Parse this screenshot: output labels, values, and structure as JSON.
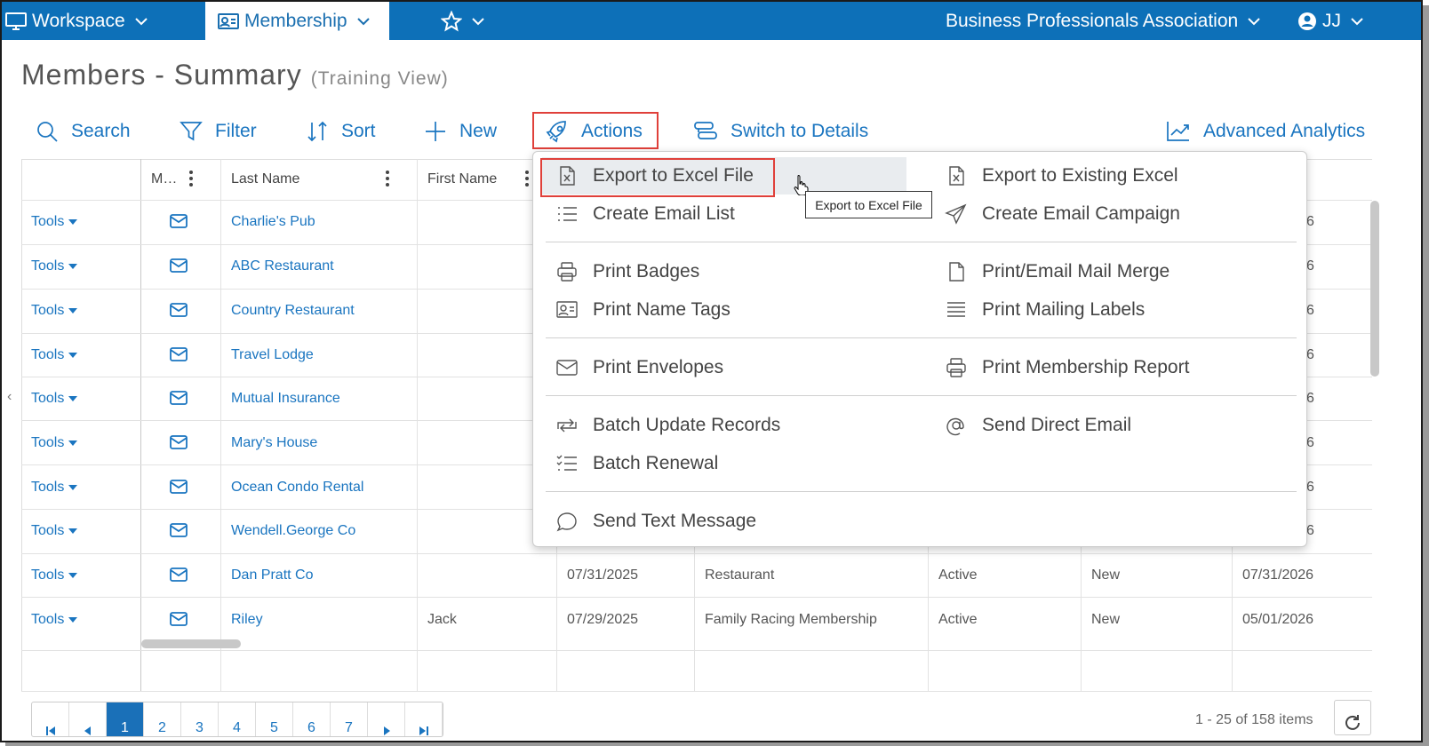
{
  "topnav": {
    "workspace": "Workspace",
    "membership": "Membership",
    "org": "Business Professionals Association",
    "user": "JJ"
  },
  "page": {
    "title": "Members - Summary",
    "subtitle": "(Training View)"
  },
  "toolbar": {
    "search": "Search",
    "filter": "Filter",
    "sort": "Sort",
    "new": "New",
    "actions": "Actions",
    "switch": "Switch to Details",
    "analytics": "Advanced Analytics"
  },
  "grid": {
    "headers": {
      "m": "M…",
      "last": "Last Name",
      "first": "First Name"
    },
    "tools_label": "Tools",
    "rows": [
      {
        "last": "Charlie's Pub",
        "first": "",
        "d1": "",
        "type": "",
        "status": "",
        "kind": "",
        "d2": "6"
      },
      {
        "last": "ABC Restaurant",
        "first": "",
        "d1": "",
        "type": "",
        "status": "",
        "kind": "",
        "d2": "6"
      },
      {
        "last": "Country Restaurant",
        "first": "",
        "d1": "",
        "type": "",
        "status": "",
        "kind": "",
        "d2": "6"
      },
      {
        "last": "Travel Lodge",
        "first": "",
        "d1": "",
        "type": "",
        "status": "",
        "kind": "",
        "d2": "6"
      },
      {
        "last": "Mutual Insurance",
        "first": "",
        "d1": "",
        "type": "",
        "status": "",
        "kind": "",
        "d2": "6"
      },
      {
        "last": "Mary's House",
        "first": "",
        "d1": "",
        "type": "",
        "status": "",
        "kind": "",
        "d2": "6"
      },
      {
        "last": "Ocean Condo Rental",
        "first": "",
        "d1": "",
        "type": "",
        "status": "",
        "kind": "",
        "d2": "6"
      },
      {
        "last": "Wendell.George Co",
        "first": "",
        "d1": "",
        "type": "",
        "status": "",
        "kind": "",
        "d2": "6"
      },
      {
        "last": "Dan Pratt Co",
        "first": "",
        "d1": "07/31/2025",
        "type": "Restaurant",
        "status": "Active",
        "kind": "New",
        "d2": "07/31/2026"
      },
      {
        "last": "Riley",
        "first": "Jack",
        "d1": "07/29/2025",
        "type": "Family Racing Membership",
        "status": "Active",
        "kind": "New",
        "d2": "05/01/2026"
      }
    ]
  },
  "pager": {
    "pages": [
      "1",
      "2",
      "3",
      "4",
      "5",
      "6",
      "7"
    ],
    "current": "1",
    "info": "1 - 25 of 158 items"
  },
  "menu": {
    "export_excel": "Export to Excel File",
    "export_existing": "Export to Existing Excel",
    "email_list": "Create Email List",
    "email_campaign": "Create Email Campaign",
    "print_badges": "Print Badges",
    "mail_merge": "Print/Email Mail Merge",
    "name_tags": "Print Name Tags",
    "mailing_labels": "Print Mailing Labels",
    "envelopes": "Print Envelopes",
    "membership_report": "Print Membership Report",
    "batch_update": "Batch Update Records",
    "direct_email": "Send Direct Email",
    "batch_renewal": "Batch Renewal",
    "text_message": "Send Text Message"
  },
  "tooltip": "Export to Excel File"
}
